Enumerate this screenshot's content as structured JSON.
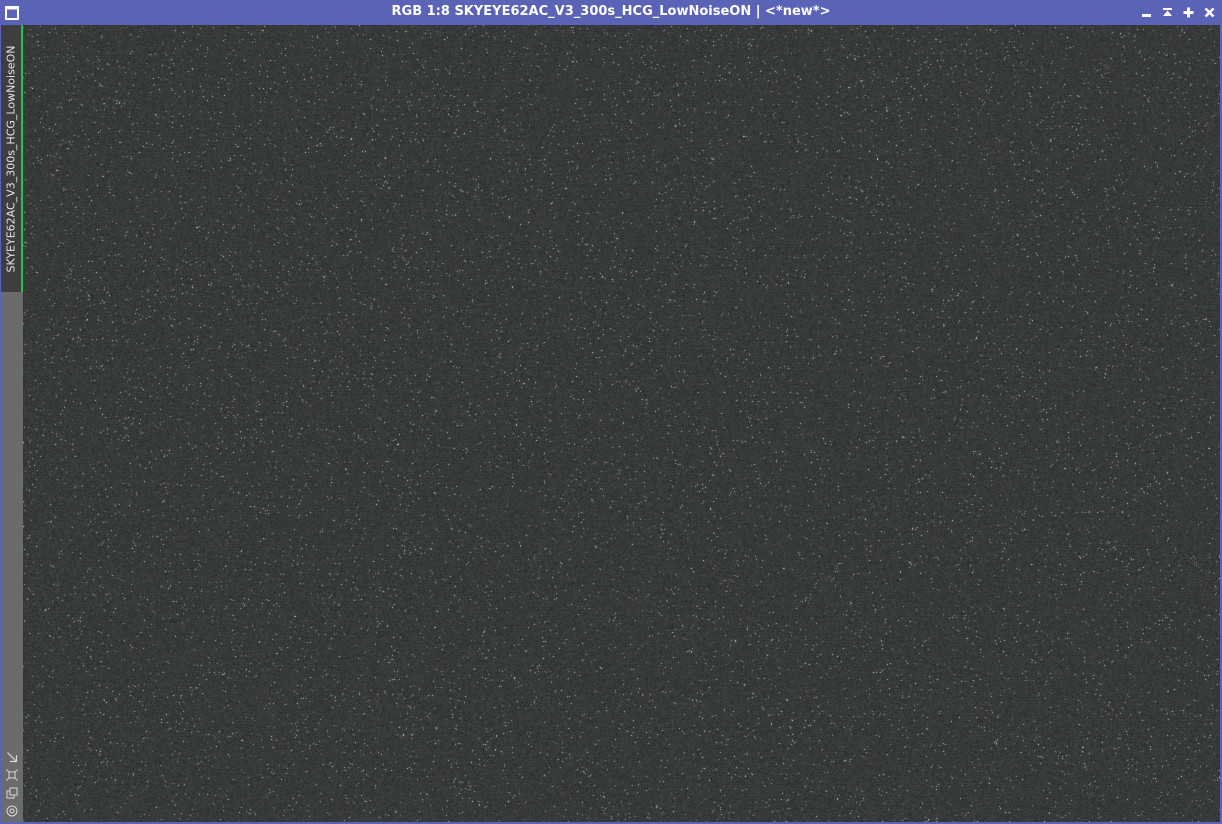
{
  "window": {
    "title": "RGB 1:8 SKYEYE62AC_V3_300s_HCG_LowNoiseON | <*new*>",
    "icon": "image-window-icon",
    "controls": [
      "minimize-icon",
      "shade-icon",
      "maximize-icon",
      "close-icon"
    ]
  },
  "sidebar": {
    "tab_label": "SKYEYE62AC_V3_300s_HCG_LowNoiseON",
    "tab_accent": "#1fc25a",
    "icons": [
      "drag-arrow-icon",
      "fit-view-icon",
      "clone-icon",
      "target-icon"
    ]
  },
  "image": {
    "description_type": "star-field",
    "background": "#393b3a"
  },
  "colors": {
    "titlebar": "#5a63b6",
    "sidebar": "#6b6b6b",
    "tab": "#3e3e3e"
  }
}
